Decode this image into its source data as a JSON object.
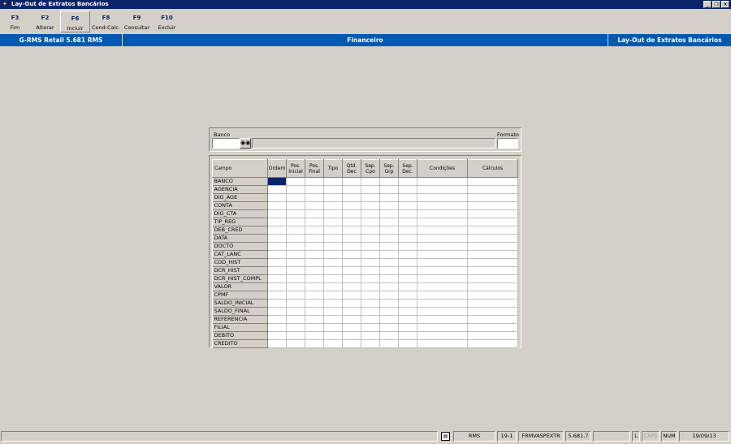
{
  "window": {
    "title": "Lay-Out de Extratos Bancários"
  },
  "toolbar": [
    {
      "key": "F3",
      "label": "Fim"
    },
    {
      "key": "F2",
      "label": "Alterar"
    },
    {
      "key": "F6",
      "label": "Incluir"
    },
    {
      "key": "F8",
      "label": "Cond-Calc."
    },
    {
      "key": "F9",
      "label": "Consultar"
    },
    {
      "key": "F10",
      "label": "Excluir"
    }
  ],
  "infobar": {
    "system": "G-RMS Retail 5.681 RMS",
    "module": "Financeiro",
    "screen": "Lay-Out de Extratos Bancários"
  },
  "filter": {
    "banco_label": "Banco",
    "banco_value": "",
    "banco_desc": "",
    "formato_label": "Formato",
    "formato_value": ""
  },
  "grid": {
    "columns": [
      "Campo",
      "Ordem",
      "Pos. Inicial",
      "Pos. Final",
      "Tipo",
      "Qtd. Dec",
      "Sep. Cpo",
      "Sep. Grp",
      "Sep. Dec.",
      "Condições",
      "Cálculos"
    ],
    "rows": [
      "BANCO",
      "AGENCIA",
      "DIG_AGE",
      "CONTA",
      "DIG_CTA",
      "TIP_REG",
      "DEB_CRED",
      "DATA",
      "DOCTO",
      "CAT_LANC",
      "COD_HIST",
      "DCR_HIST",
      "DCR_HIST_COMPL",
      "VALOR",
      "CPMF",
      "SALDO_INICIAL",
      "SALDO_FINAL",
      "REFERENCIA",
      "FILIAL",
      "DEBITO",
      "CREDITO"
    ]
  },
  "status": {
    "message": "",
    "user": "RMS",
    "code": "19-1",
    "form": "FRMVASPEXTR",
    "version": "5.681.7",
    "blank": "",
    "l": "L",
    "caps": "CAPS",
    "num": "NUM",
    "date": "19/09/13"
  }
}
